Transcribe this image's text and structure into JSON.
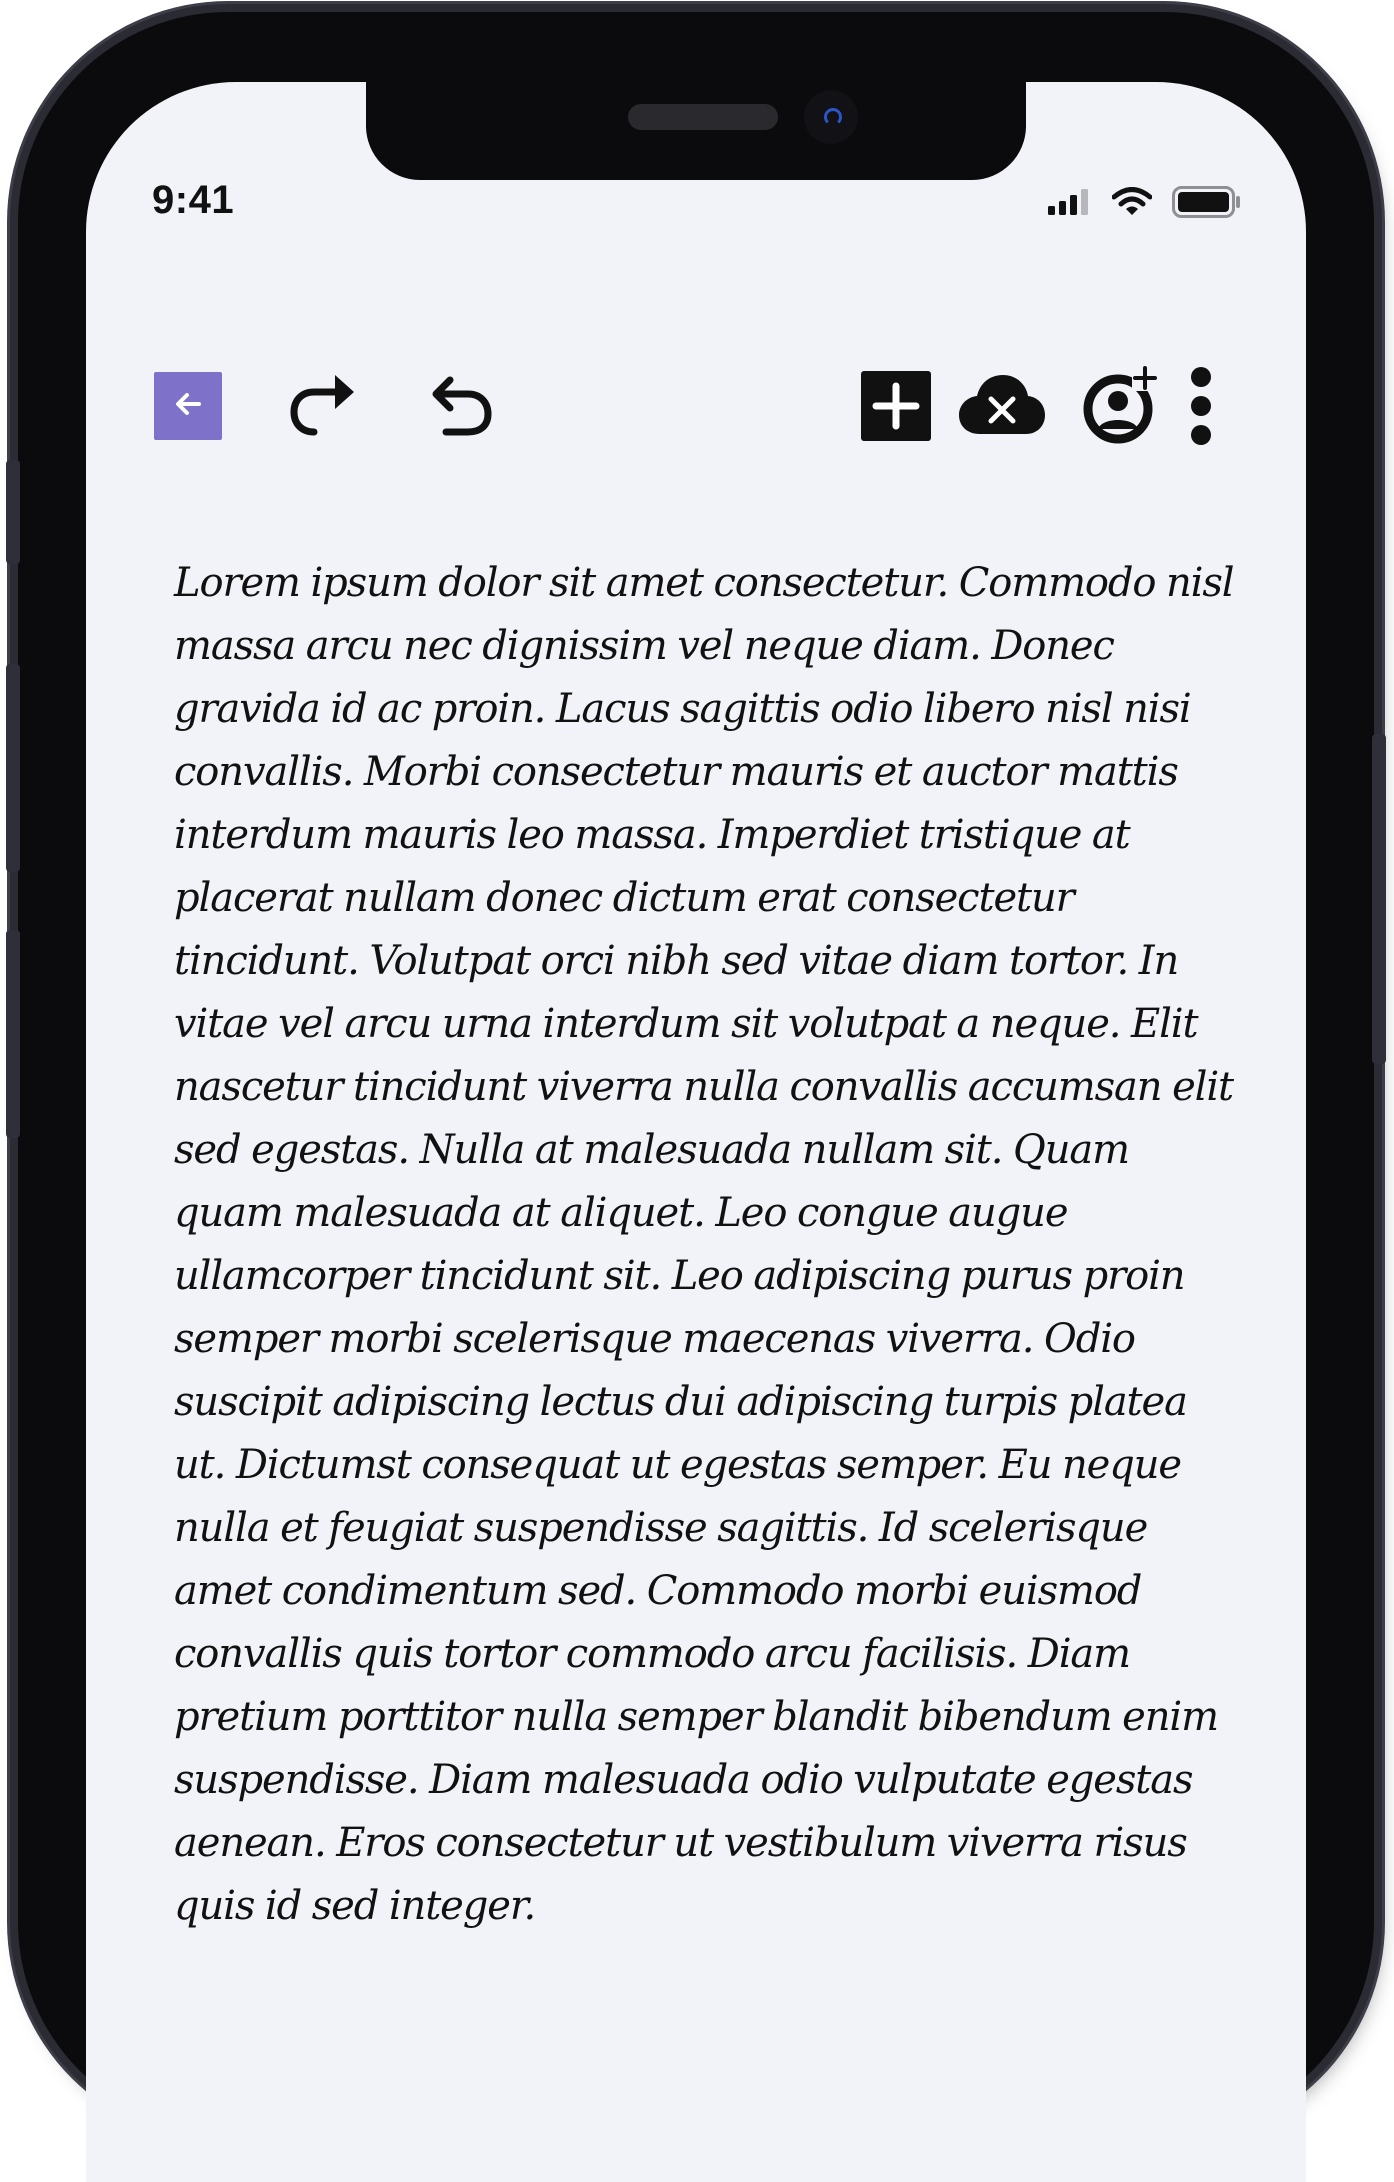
{
  "status_bar": {
    "time": "9:41",
    "icons": [
      "cellular-signal-icon",
      "wifi-icon",
      "battery-icon"
    ]
  },
  "toolbar": {
    "left": [
      "back-arrow-icon",
      "redo-icon",
      "undo-icon"
    ],
    "right": [
      "add-box-icon",
      "cloud-off-icon",
      "add-person-icon",
      "more-vertical-icon"
    ],
    "accent_color": "#7e71c9"
  },
  "content": {
    "text": "Lorem ipsum dolor sit amet consectetur. Commodo nisl massa arcu nec dignissim vel neque diam. Donec gravida id ac proin. Lacus sagittis odio libero nisl nisi convallis. Morbi consectetur mauris et auctor mattis interdum mauris leo massa. Imperdiet tristique at placerat nullam donec dictum erat consectetur tincidunt. Volutpat orci nibh sed vitae diam tortor. In vitae vel arcu urna interdum sit volutpat a neque. Elit nascetur tincidunt viverra nulla convallis accumsan elit sed egestas. Nulla at malesuada nullam sit. Quam quam malesuada at aliquet. Leo congue augue ullamcorper tincidunt sit. Leo adipiscing purus proin semper morbi scelerisque maecenas viverra. Odio suscipit adipiscing lectus dui adipiscing turpis platea ut. Dictumst consequat ut egestas semper. Eu neque nulla et feugiat suspendisse sagittis. Id scelerisque amet condimentum sed. Commodo morbi euismod convallis quis tortor commodo arcu facilisis. Diam pretium porttitor nulla semper blandit bibendum enim suspendisse. Diam malesuada odio vulputate egestas aenean. Eros consectetur ut vestibulum viverra risus quis id sed integer."
  }
}
